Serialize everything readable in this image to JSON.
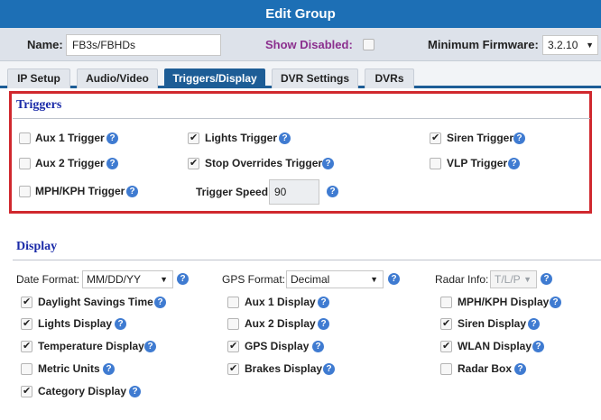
{
  "window": {
    "title": "Edit Group"
  },
  "top": {
    "name_label": "Name:",
    "name_value": "FB3s/FBHDs",
    "show_disabled_label": "Show Disabled:",
    "show_disabled_checked": false,
    "firmware_label": "Minimum Firmware:",
    "firmware_value": "3.2.10"
  },
  "tabs": [
    {
      "label": "IP Setup",
      "active": false
    },
    {
      "label": "Audio/Video",
      "active": false
    },
    {
      "label": "Triggers/Display",
      "active": true
    },
    {
      "label": "DVR Settings",
      "active": false
    },
    {
      "label": "DVRs",
      "active": false
    }
  ],
  "triggers": {
    "title": "Triggers",
    "items": [
      {
        "label": "Aux 1 Trigger",
        "checked": false
      },
      {
        "label": "Lights Trigger",
        "checked": true
      },
      {
        "label": "Siren Trigger",
        "checked": true
      },
      {
        "label": "Aux 2 Trigger",
        "checked": false
      },
      {
        "label": "Stop Overrides Trigger",
        "checked": true
      },
      {
        "label": "VLP Trigger",
        "checked": false
      },
      {
        "label": "MPH/KPH Trigger",
        "checked": false
      }
    ],
    "speed_label": "Trigger Speed:",
    "speed_value": "90"
  },
  "display": {
    "title": "Display",
    "date_format_label": "Date Format:",
    "date_format_value": "MM/DD/YY",
    "gps_format_label": "GPS Format:",
    "gps_format_value": "Decimal",
    "radar_info_label": "Radar Info:",
    "radar_info_value": "T/L/P",
    "items": [
      {
        "label": "Daylight Savings Time",
        "checked": true
      },
      {
        "label": "Aux 1 Display",
        "checked": false
      },
      {
        "label": "MPH/KPH Display",
        "checked": false
      },
      {
        "label": "Lights Display",
        "checked": true
      },
      {
        "label": "Aux 2 Display",
        "checked": false
      },
      {
        "label": "Siren Display",
        "checked": true
      },
      {
        "label": "Temperature Display",
        "checked": true
      },
      {
        "label": "GPS Display",
        "checked": true
      },
      {
        "label": "WLAN Display",
        "checked": true
      },
      {
        "label": "Metric Units",
        "checked": false
      },
      {
        "label": "Brakes Display",
        "checked": true
      },
      {
        "label": "Radar Box",
        "checked": false
      },
      {
        "label": "Category Display",
        "checked": true
      }
    ]
  },
  "icons": {
    "help": "help-icon",
    "dropdown": "chevron-down-icon",
    "check": "check-icon"
  },
  "colors": {
    "header": "#1d6fb5",
    "active_tab": "#1d5d96",
    "highlight_box": "#d0282e",
    "section_title": "#1a2aa8",
    "help_icon": "#3f7bd1"
  }
}
